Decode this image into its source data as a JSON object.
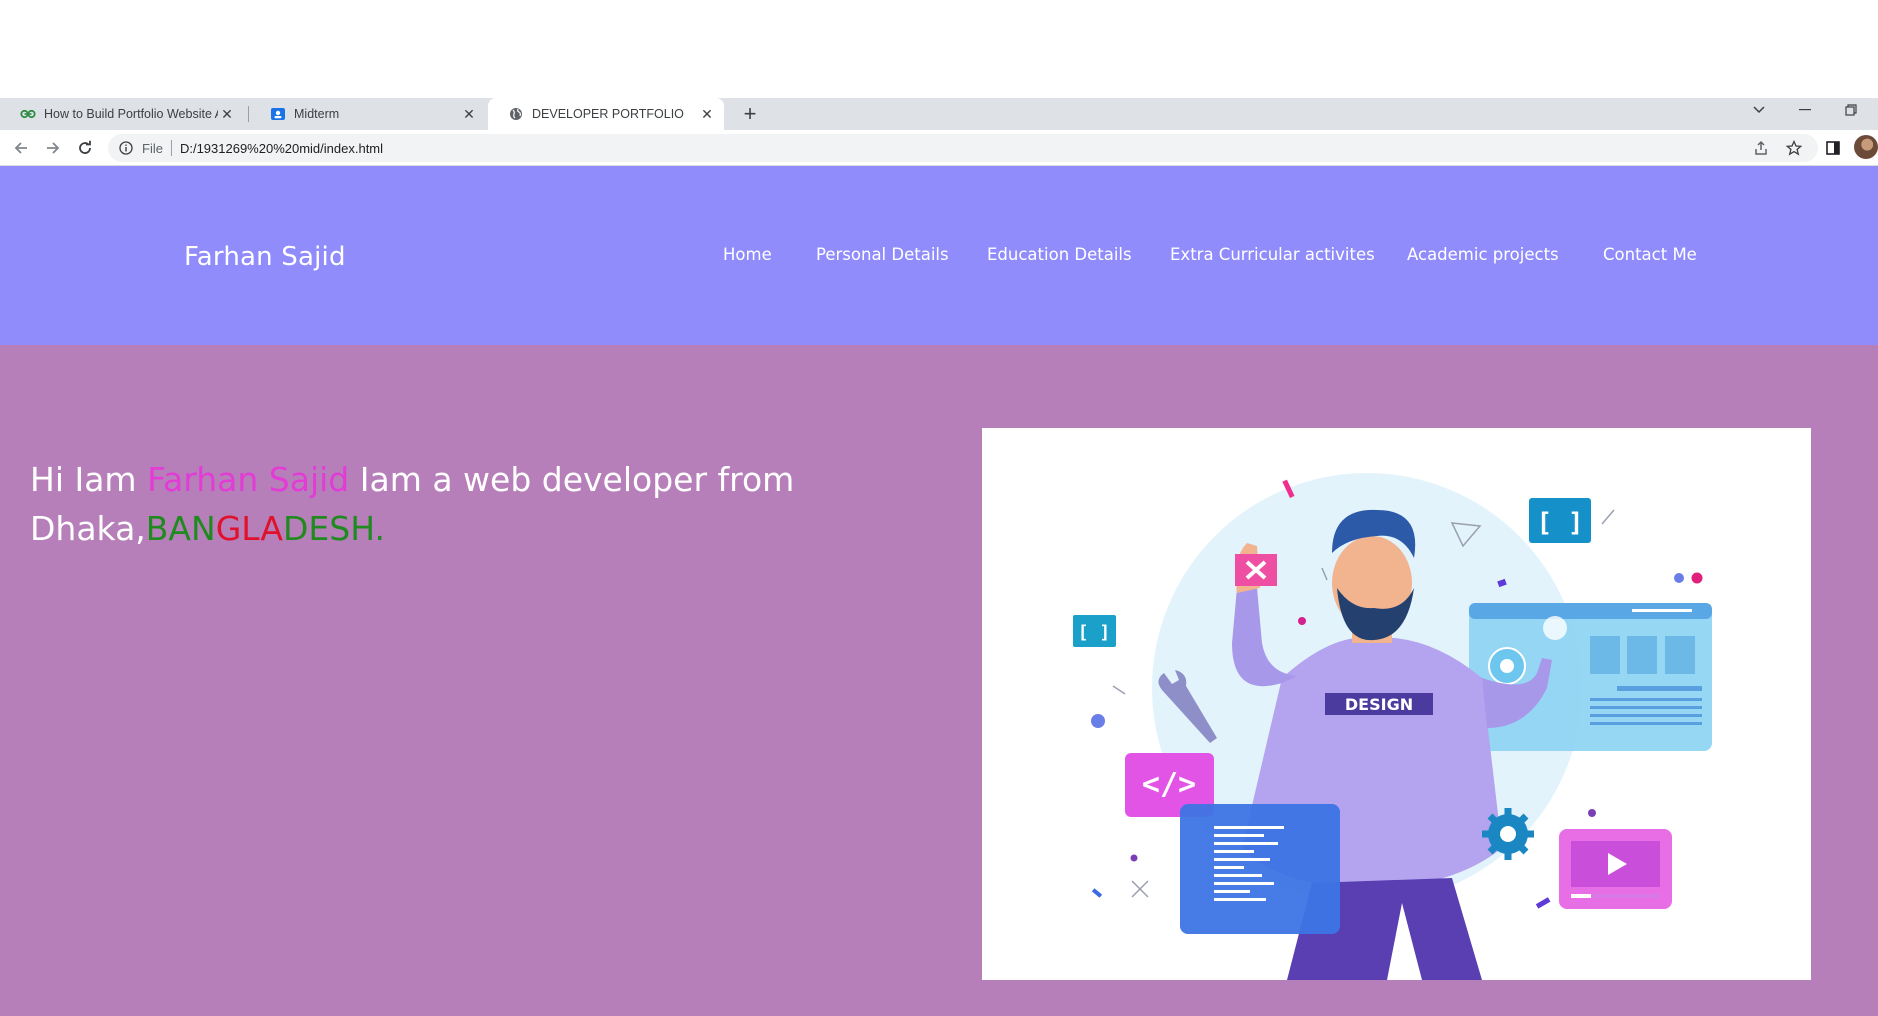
{
  "browser": {
    "tabs": [
      {
        "title": "How to Build Portfolio Website A",
        "icon": "geeksforgeeks-icon",
        "active": false
      },
      {
        "title": "Midterm",
        "icon": "classroom-icon",
        "active": false
      },
      {
        "title": "DEVELOPER PORTFOLIO",
        "icon": "globe-icon",
        "active": true
      }
    ],
    "address": {
      "scheme": "File",
      "url": "D:/1931269%20%20mid/index.html"
    }
  },
  "header": {
    "brand": "Farhan Sajid",
    "nav": [
      {
        "label": "Home"
      },
      {
        "label": "Personal Details"
      },
      {
        "label": "Education Details"
      },
      {
        "label": "Extra Curricular activites"
      },
      {
        "label": "Academic projects"
      },
      {
        "label": "Contact Me"
      }
    ]
  },
  "hero": {
    "intro_prefix": "Hi Iam ",
    "intro_name": "Farhan Sajid",
    "intro_middle": " Iam a web developer from Dhaka,",
    "country_parts": [
      "BAN",
      "GLA",
      "DESH",
      "."
    ],
    "illustration_label": "DESIGN"
  },
  "colors": {
    "header_bg": "#918cfc",
    "hero_bg": "#b77fba",
    "name_color": "#e23bd6",
    "green": "#1f8b1f",
    "red": "#e0112b"
  }
}
